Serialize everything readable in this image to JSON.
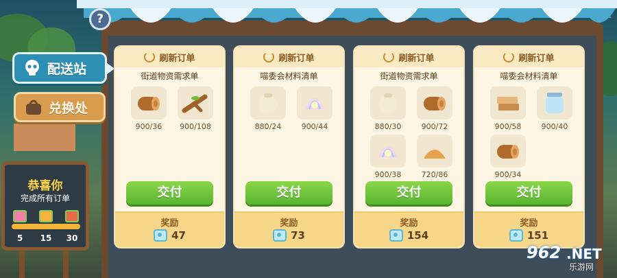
{
  "help": {
    "label": "?"
  },
  "sidebar": {
    "tabs": [
      {
        "label": "配送站",
        "icon": "skull-icon"
      },
      {
        "label": "兑换处",
        "icon": "bag-icon"
      }
    ]
  },
  "board": {
    "title": "恭喜你",
    "subtitle": "完成所有订单",
    "milestones": [
      "5",
      "15",
      "30"
    ]
  },
  "orders": [
    {
      "refresh_label": "刷新订单",
      "title": "街道物资需求单",
      "items": [
        {
          "icon": "wood-log-icon",
          "qty": "900/36"
        },
        {
          "icon": "branch-icon",
          "qty": "900/108"
        }
      ],
      "deliver_label": "交付",
      "reward_label": "奖励",
      "reward_value": "47"
    },
    {
      "refresh_label": "刷新订单",
      "title": "喵委会材料清单",
      "items": [
        {
          "icon": "pot-icon",
          "qty": "880/24"
        },
        {
          "icon": "shell-icon",
          "qty": "900/44"
        }
      ],
      "deliver_label": "交付",
      "reward_label": "奖励",
      "reward_value": "73"
    },
    {
      "refresh_label": "刷新订单",
      "title": "街道物资需求单",
      "items": [
        {
          "icon": "pot-icon",
          "qty": "880/30"
        },
        {
          "icon": "wood-log-icon",
          "qty": "900/72"
        },
        {
          "icon": "shell-icon",
          "qty": "900/38"
        },
        {
          "icon": "sand-icon",
          "qty": "720/86"
        }
      ],
      "deliver_label": "交付",
      "reward_label": "奖励",
      "reward_value": "154"
    },
    {
      "refresh_label": "刷新订单",
      "title": "喵委会材料清单",
      "items": [
        {
          "icon": "plank-icon",
          "qty": "900/58"
        },
        {
          "icon": "jar-icon",
          "qty": "900/40"
        },
        {
          "icon": "wood-log-icon",
          "qty": "900/34"
        }
      ],
      "deliver_label": "交付",
      "reward_label": "奖励",
      "reward_value": "151"
    }
  ],
  "watermark": {
    "number": "962",
    "domain": ".NET",
    "sub": "乐游网"
  },
  "colors": {
    "accent_blue": "#2c8fb3",
    "deliver_green": "#58b52f",
    "card_cream": "#fdf6e4",
    "reward_yellow": "#f6d689"
  }
}
